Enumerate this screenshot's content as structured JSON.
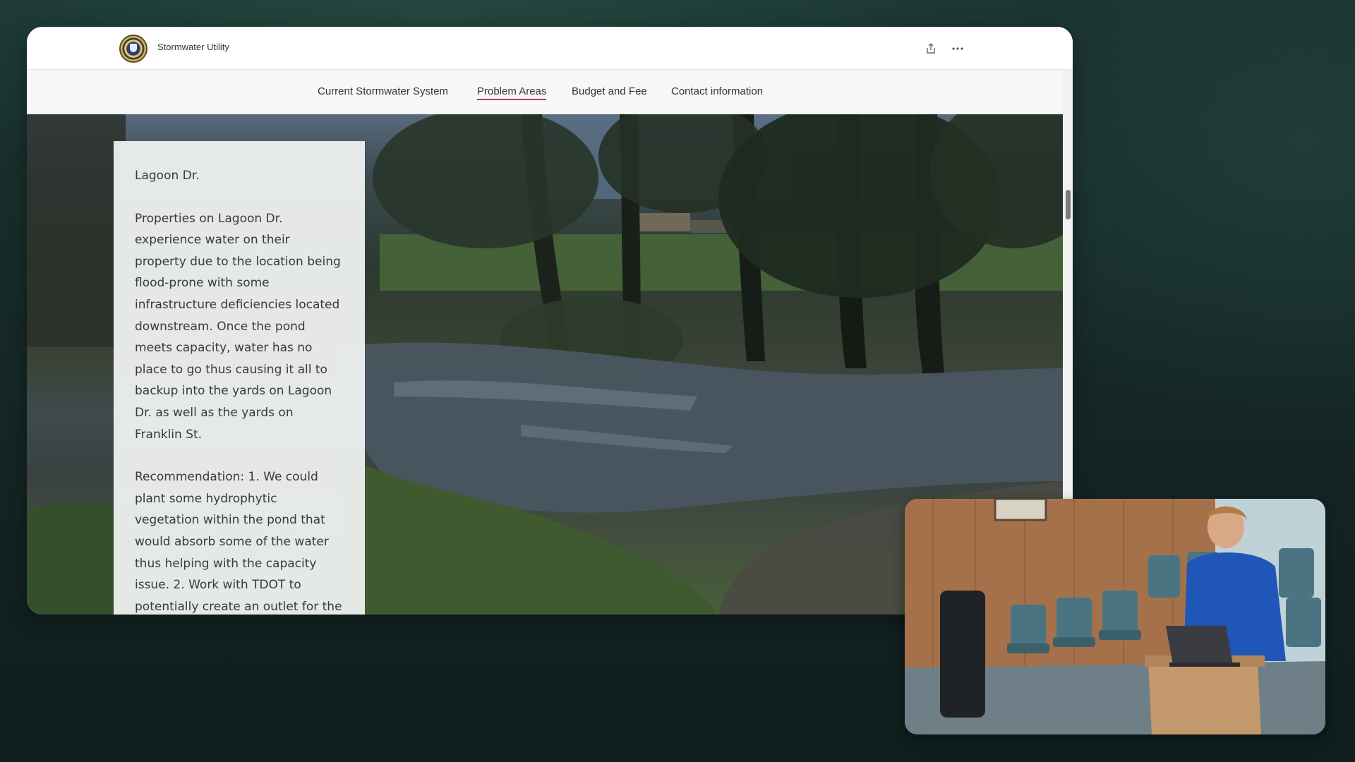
{
  "site": {
    "title": "Stormwater Utility",
    "logo_icon": "city-seal-icon",
    "share_icon": "share-icon",
    "more_icon": "more-horizontal-icon"
  },
  "nav": {
    "items": [
      {
        "label": "Current Stormwater System",
        "active": false
      },
      {
        "label": "Problem Areas",
        "active": true
      },
      {
        "label": "Budget and Fee",
        "active": false
      },
      {
        "label": "Contact information",
        "active": false
      }
    ],
    "active_color": "#c0354a"
  },
  "content": {
    "heading": "Lagoon Dr.",
    "paragraph1": "Properties on Lagoon Dr. experience water on their property due to the location being flood-prone with some infrastructure deficiencies located downstream. Once the pond meets capacity, water has no place to go thus causing it all to backup into the yards on Lagoon Dr. as well as the yards on Franklin St.",
    "paragraph2": "Recommendation: 1. We could plant some hydrophytic vegetation within the pond that would absorb some of the water thus helping with the capacity issue. 2. Work with TDOT to potentially create an outlet for the water underneath the highway and into a sinkhole."
  },
  "hero_image": {
    "subject": "flooded yard with trees at dusk"
  },
  "webcam": {
    "subject": "presenter at podium with laptop in meeting room"
  }
}
